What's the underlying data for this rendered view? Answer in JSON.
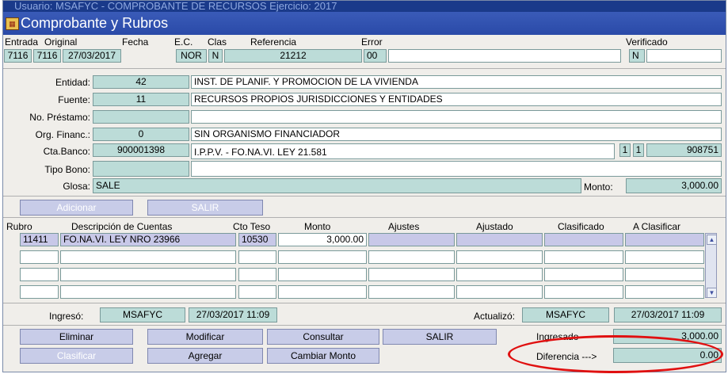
{
  "window": {
    "outer_title": "Usuario: MSAFYC  -  COMPROBANTE DE RECURSOS  Ejercicio: 2017",
    "title": "Comprobante y Rubros"
  },
  "header": {
    "labels": {
      "entrada": "Entrada",
      "original": "Original",
      "fecha": "Fecha",
      "ec": "E.C.",
      "clas": "Clas",
      "referencia": "Referencia",
      "error": "Error",
      "verificado": "Verificado"
    },
    "values": {
      "entrada": "7116",
      "original": "7116",
      "fecha": "27/03/2017",
      "ec": "NOR",
      "clas": "N",
      "referencia": "21212",
      "error": "00",
      "error_desc": "",
      "verificado": "N",
      "verificado_desc": ""
    }
  },
  "details": {
    "entidad": {
      "label": "Entidad:",
      "code": "42",
      "desc": "INST. DE PLANIF. Y PROMOCION DE LA VIVIENDA"
    },
    "fuente": {
      "label": "Fuente:",
      "code": "11",
      "desc": "RECURSOS PROPIOS JURISDICCIONES Y ENTIDADES"
    },
    "prestamo": {
      "label": "No. Préstamo:",
      "code": "",
      "desc": ""
    },
    "org_financ": {
      "label": "Org. Financ.:",
      "code": "0",
      "desc": "SIN ORGANISMO FINANCIADOR"
    },
    "cta_banco": {
      "label": "Cta.Banco:",
      "code": "900001398",
      "desc": "I.P.P.V. - FO.NA.VI. LEY 21.581",
      "extra1": "1",
      "extra2": "1",
      "extra3": "908751"
    },
    "tipo_bono": {
      "label": "Tipo Bono:",
      "code": "",
      "desc": ""
    },
    "glosa": {
      "label": "Glosa:",
      "value": "SALE"
    },
    "monto": {
      "label": "Monto:",
      "value": "3,000.00"
    }
  },
  "actions_top": {
    "adicionar": "Adicionar",
    "salir": "SALIR"
  },
  "table": {
    "headers": [
      "Rubro",
      "Descripción de Cuentas",
      "Cto Teso",
      "Monto",
      "Ajustes",
      "Ajustado",
      "Clasificado",
      "A Clasificar"
    ],
    "rows": [
      [
        "11411",
        "FO.NA.VI. LEY NRO 23966",
        "10530",
        "3,000.00",
        "",
        "",
        "",
        ""
      ],
      [
        "",
        "",
        "",
        "",
        "",
        "",
        "",
        ""
      ],
      [
        "",
        "",
        "",
        "",
        "",
        "",
        "",
        ""
      ],
      [
        "",
        "",
        "",
        "",
        "",
        "",
        "",
        ""
      ]
    ]
  },
  "audit": {
    "ingreso_label": "Ingresó:",
    "ingreso_user": "MSAFYC",
    "ingreso_date": "27/03/2017 11:09",
    "actualizo_label": "Actualizó:",
    "actualizo_user": "MSAFYC",
    "actualizo_date": "27/03/2017 11:09"
  },
  "actions_bottom": {
    "eliminar": "Eliminar",
    "modificar": "Modificar",
    "consultar": "Consultar",
    "salir": "SALIR",
    "clasificar": "Clasificar",
    "agregar": "Agregar",
    "cambiar_monto": "Cambiar Monto"
  },
  "totals": {
    "ingresado_label": "Ingresado",
    "ingresado_value": "3,000.00",
    "diferencia_label": "Diferencia --->",
    "diferencia_value": "0.00"
  },
  "colors": {
    "field_teal": "#bcdcd8",
    "field_purple": "#c8c8e8",
    "title_bar": "#2a4aa8",
    "highlight": "#e01010"
  }
}
